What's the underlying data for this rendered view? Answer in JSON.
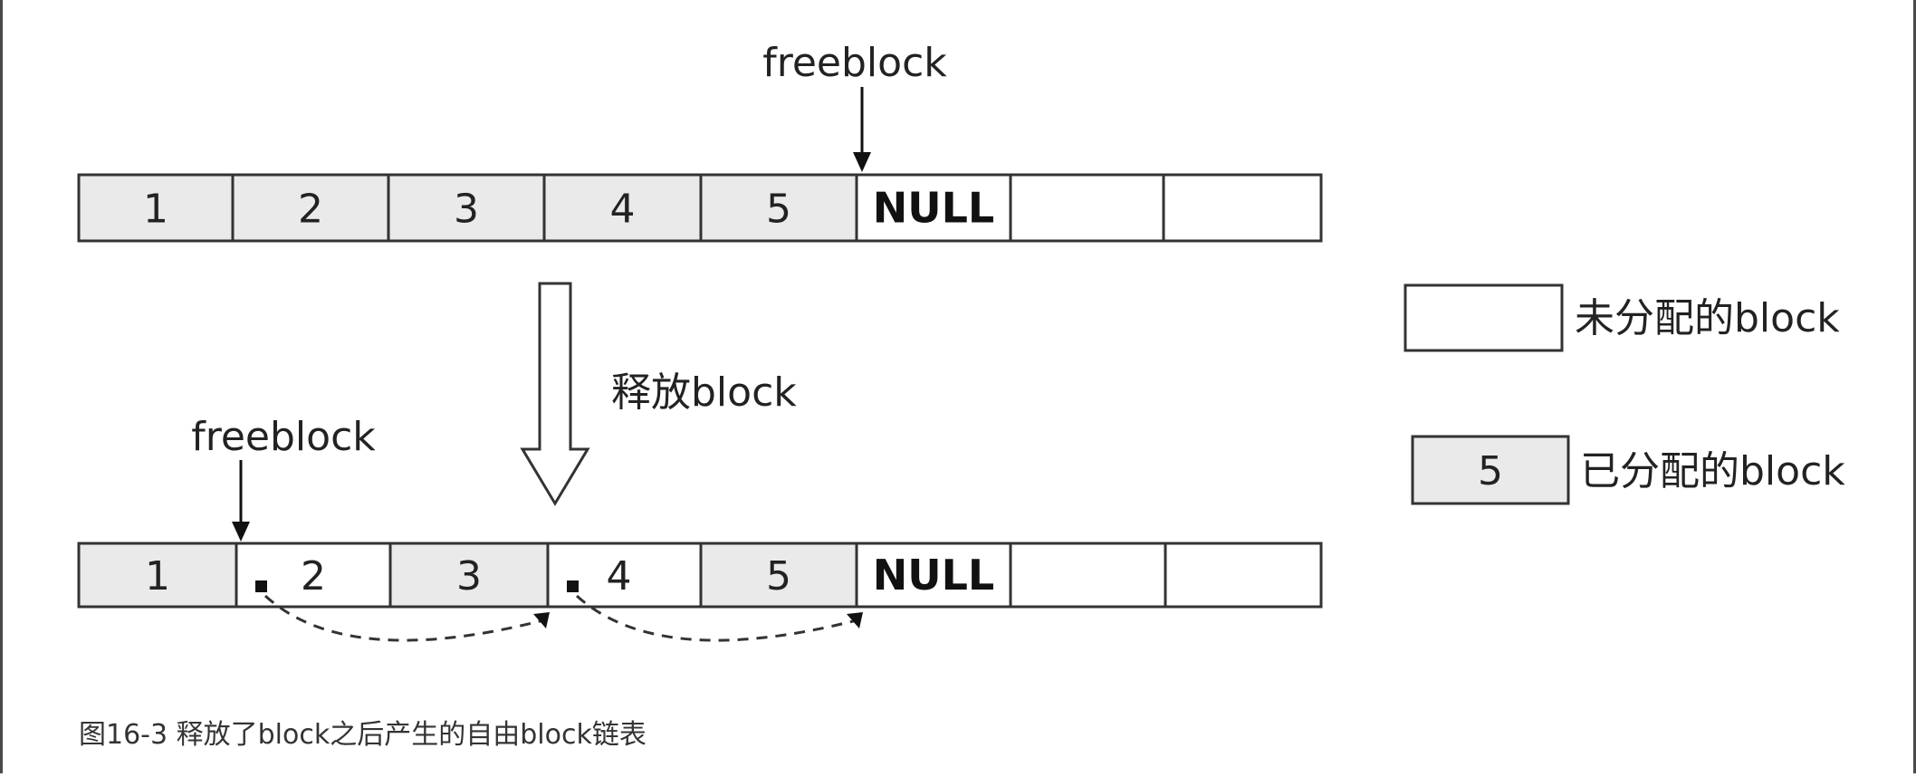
{
  "colors": {
    "allocated_fill": "#eaeaea",
    "free_fill": "#ffffff",
    "stroke": "#333333"
  },
  "top_row": {
    "pointer_label": "freeblock",
    "cells": [
      {
        "label": "1",
        "state": "allocated"
      },
      {
        "label": "2",
        "state": "allocated"
      },
      {
        "label": "3",
        "state": "allocated"
      },
      {
        "label": "4",
        "state": "allocated"
      },
      {
        "label": "5",
        "state": "allocated"
      },
      {
        "label": "NULL",
        "state": "free"
      },
      {
        "label": "",
        "state": "free"
      },
      {
        "label": "",
        "state": "free"
      }
    ]
  },
  "transition_label": "释放block",
  "bottom_row": {
    "pointer_label": "freeblock",
    "cells": [
      {
        "label": "1",
        "state": "allocated"
      },
      {
        "label": "2",
        "state": "free"
      },
      {
        "label": "3",
        "state": "allocated"
      },
      {
        "label": "4",
        "state": "free"
      },
      {
        "label": "5",
        "state": "allocated"
      },
      {
        "label": "NULL",
        "state": "free"
      },
      {
        "label": "",
        "state": "free"
      },
      {
        "label": "",
        "state": "free"
      }
    ]
  },
  "legend": {
    "free_label": "未分配的block",
    "allocated_sample": "5",
    "allocated_label": "已分配的block"
  },
  "caption": "图16-3 释放了block之后产生的自由block链表"
}
